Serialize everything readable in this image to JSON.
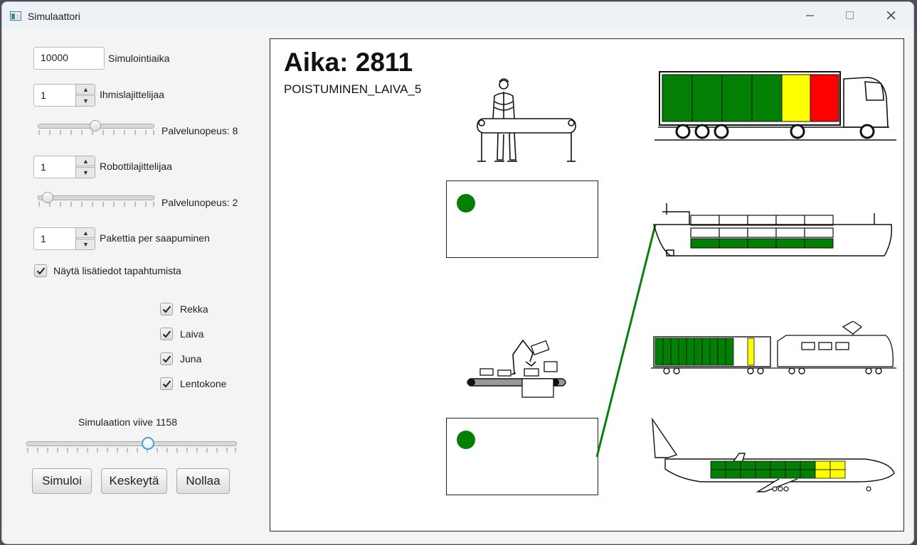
{
  "window": {
    "title": "Simulaattori"
  },
  "controls": {
    "simulation_time": {
      "value": "10000",
      "label": "Simulointiaika"
    },
    "human_sorters": {
      "value": "1",
      "label": "Ihmislajittelijaa"
    },
    "human_speed": {
      "label": "Palvelunopeus: 8",
      "level": 8
    },
    "robot_sorters": {
      "value": "1",
      "label": "Robottilajittelijaa"
    },
    "robot_speed": {
      "label": "Palvelunopeus: 2",
      "level": 2
    },
    "packages": {
      "value": "1",
      "label": "Pakettia per saapuminen"
    },
    "show_details": {
      "label": "Näytä lisätiedot tapahtumista",
      "checked": true
    },
    "vehicles": [
      {
        "label": "Rekka",
        "checked": true
      },
      {
        "label": "Laiva",
        "checked": true
      },
      {
        "label": "Juna",
        "checked": true
      },
      {
        "label": "Lentokone",
        "checked": true
      }
    ],
    "delay": {
      "label": "Simulaation viive 1158",
      "value": 1158
    },
    "buttons": {
      "simulate": "Simuloi",
      "pause": "Keskeytä",
      "reset": "Nollaa"
    }
  },
  "canvas": {
    "time": "Aika: 2811",
    "event": "POISTUMINEN_LAIVA_5"
  },
  "colors": {
    "loaded": "#038003",
    "partial": "#ffff00",
    "full": "#ff0000",
    "route_line": "#0a7f0a"
  },
  "cargo": {
    "truck": [
      "loaded",
      "loaded",
      "loaded",
      "loaded",
      "partial",
      "full"
    ],
    "ship_upper": [
      "empty",
      "empty",
      "empty",
      "empty",
      "empty"
    ],
    "ship_lower": [
      "loaded",
      "loaded",
      "loaded",
      "loaded",
      "loaded"
    ],
    "train": [
      "loaded",
      "loaded",
      "loaded",
      "loaded",
      "loaded",
      "loaded",
      "loaded",
      "loaded",
      "loaded",
      "loaded",
      "partial",
      "empty"
    ],
    "plane": [
      "loaded",
      "loaded",
      "loaded",
      "loaded",
      "loaded",
      "loaded",
      "loaded",
      "partial",
      "partial"
    ]
  },
  "icons": [
    "app-icon",
    "minimize-icon",
    "maximize-icon",
    "close-icon",
    "check-icon",
    "human-sorter-icon",
    "robot-sorter-icon",
    "truck-icon",
    "ship-icon",
    "train-icon",
    "airplane-icon"
  ]
}
